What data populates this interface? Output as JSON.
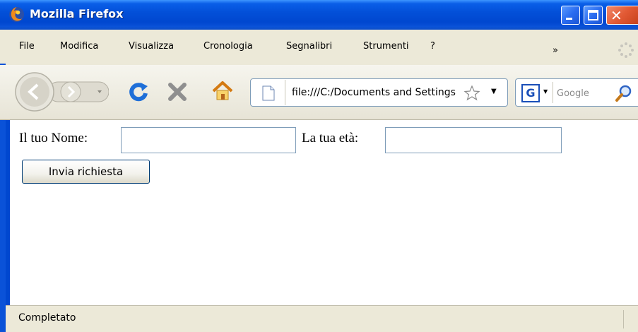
{
  "window": {
    "title": "Mozilla Firefox",
    "colors": {
      "titlebar": "#0350d9",
      "close_button": "#e25a35",
      "chrome": "#ece9d8"
    }
  },
  "menu": {
    "items": [
      {
        "label": "File"
      },
      {
        "label": "Modifica"
      },
      {
        "label": "Visualizza"
      },
      {
        "label": "Cronologia"
      },
      {
        "label": "Segnalibri"
      },
      {
        "label": "Strumenti"
      },
      {
        "label": "?"
      }
    ],
    "overflow_label": "»"
  },
  "toolbar": {
    "back_icon": "back-arrow-icon",
    "forward_icon": "forward-arrow-icon",
    "reload_icon": "reload-icon",
    "stop_icon": "stop-icon",
    "home_icon": "home-icon",
    "url": "file:///C:/Documents and Settings",
    "bookmark_icon": "star-icon",
    "search_placeholder": "Google",
    "search_engine_icon": "google-icon",
    "search_engine_glyph": "G"
  },
  "form": {
    "name_label": "Il tuo Nome:",
    "name_value": "",
    "age_label": "La tua età:",
    "age_value": "",
    "submit_label": "Invia richiesta"
  },
  "status": {
    "text": "Completato"
  }
}
